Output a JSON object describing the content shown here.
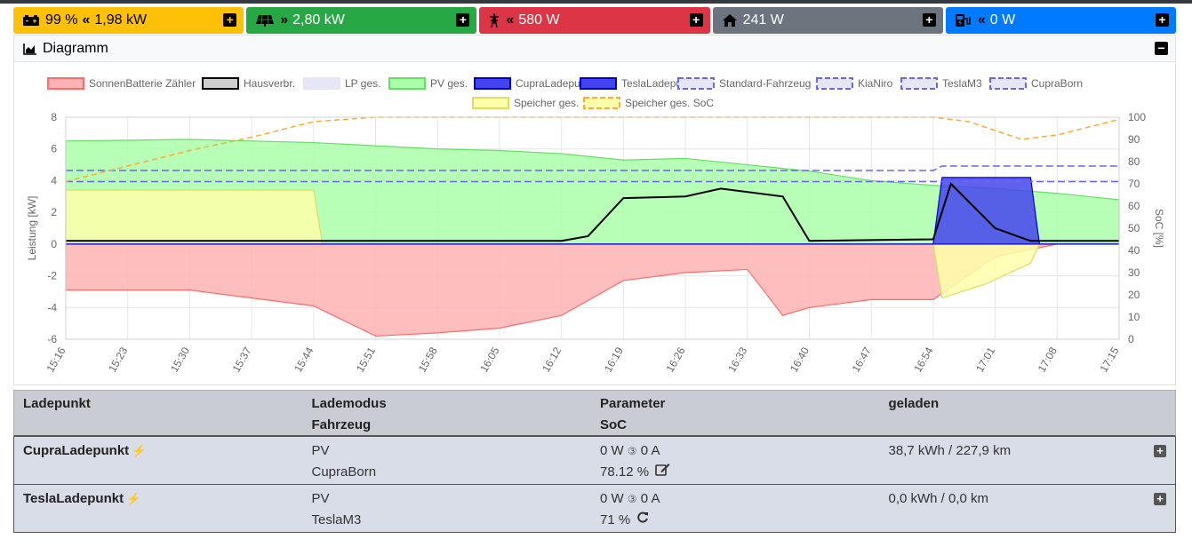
{
  "status": {
    "battery": {
      "soc": "99 %",
      "power": "1,98 kW"
    },
    "pv": {
      "power": "2,80 kW"
    },
    "grid": {
      "power": "580 W"
    },
    "house": {
      "power": "241 W"
    },
    "charge": {
      "power": "0 W"
    }
  },
  "diagram": {
    "title": "Diagramm"
  },
  "chart_data": {
    "type": "line",
    "legend": [
      {
        "name": "SonnenBatterie Zähler",
        "color": "#ff6b6b",
        "fill": "#ffb3b3",
        "dash": false
      },
      {
        "name": "Hausverbr.",
        "color": "#000000",
        "fill": "#cfcfcf",
        "dash": false
      },
      {
        "name": "LP ges.",
        "color": "#e6e6f7",
        "fill": "#e6e6f7",
        "dash": false
      },
      {
        "name": "PV ges.",
        "color": "#66dd66",
        "fill": "#aaffaa",
        "dash": false
      },
      {
        "name": "CupraLadepunkt",
        "color": "#0000cc",
        "fill": "#4444ee",
        "dash": false
      },
      {
        "name": "TeslaLadepunkt",
        "color": "#0000cc",
        "fill": "#4444ee",
        "dash": false
      },
      {
        "name": "Standard-Fahrzeug",
        "color": "#6666ee",
        "fill": "#e6e6f7",
        "dash": true
      },
      {
        "name": "KiaNiro",
        "color": "#6666ee",
        "fill": "#e6e6f7",
        "dash": true
      },
      {
        "name": "TeslaM3",
        "color": "#6666ee",
        "fill": "#e6e6f7",
        "dash": true
      },
      {
        "name": "CupraBorn",
        "color": "#6666ee",
        "fill": "#e6e6f7",
        "dash": true
      },
      {
        "name": "Speicher ges.",
        "color": "#dddd66",
        "fill": "#ffffaa",
        "dash": false
      },
      {
        "name": "Speicher ges. SoC",
        "color": "#ffaa33",
        "fill": "#ffffaa",
        "dash": true
      }
    ],
    "ylabel_left": "Leistung [kW]",
    "ylabel_right": "SoC [%]",
    "ylim_left": [
      -6,
      8
    ],
    "yticks_left": [
      "8",
      "6",
      "4",
      "2",
      "0",
      "-2",
      "-4",
      "-6"
    ],
    "ylim_right": [
      0,
      100
    ],
    "yticks_right": [
      "100",
      "90",
      "80",
      "70",
      "60",
      "50",
      "40",
      "30",
      "20",
      "10",
      "0"
    ],
    "xticks": [
      "15:16",
      "15:23",
      "15:30",
      "15:37",
      "15:44",
      "15:51",
      "15:58",
      "16:05",
      "16:12",
      "16:19",
      "16:26",
      "16:33",
      "16:40",
      "16:47",
      "16:54",
      "17:01",
      "17:08",
      "17:15"
    ],
    "series": [
      {
        "name": "PV ges.",
        "x": [
          "15:16",
          "15:30",
          "15:44",
          "15:58",
          "16:05",
          "16:12",
          "16:19",
          "16:26",
          "16:33",
          "16:40",
          "16:47",
          "16:54",
          "17:01",
          "17:08",
          "17:15"
        ],
        "values": [
          6.5,
          6.6,
          6.4,
          6.0,
          5.9,
          5.7,
          5.3,
          5.4,
          5.0,
          4.6,
          4.0,
          3.7,
          3.5,
          3.2,
          2.8
        ]
      },
      {
        "name": "SonnenBatterie Zähler",
        "x": [
          "15:16",
          "15:30",
          "15:44",
          "15:51",
          "15:58",
          "16:05",
          "16:12",
          "16:19",
          "16:26",
          "16:33",
          "16:37",
          "16:40",
          "16:47",
          "16:54",
          "17:01",
          "17:08",
          "17:15"
        ],
        "values": [
          -2.9,
          -2.9,
          -3.9,
          -5.8,
          -5.6,
          -5.3,
          -4.5,
          -2.3,
          -1.8,
          -1.6,
          -4.5,
          -4.0,
          -3.5,
          -3.5,
          -0.8,
          0.0,
          0.0
        ]
      },
      {
        "name": "Hausverbr.",
        "x": [
          "15:16",
          "15:44",
          "16:12",
          "16:15",
          "16:19",
          "16:26",
          "16:30",
          "16:37",
          "16:40",
          "16:54",
          "16:56",
          "17:01",
          "17:05",
          "17:15"
        ],
        "values": [
          0.2,
          0.2,
          0.2,
          0.5,
          2.9,
          3.0,
          3.5,
          3.0,
          0.2,
          0.3,
          3.8,
          1.0,
          0.2,
          0.2
        ]
      },
      {
        "name": "Speicher ges. SoC",
        "x": [
          "15:16",
          "15:23",
          "15:30",
          "15:37",
          "15:44",
          "15:51",
          "15:58",
          "16:05",
          "16:12",
          "16:19",
          "16:26",
          "16:33",
          "16:40",
          "16:47",
          "16:54",
          "16:58",
          "17:01",
          "17:04",
          "17:08",
          "17:15"
        ],
        "values": [
          71,
          78,
          85,
          91,
          98,
          100,
          100,
          100,
          100,
          100,
          100,
          100,
          100,
          100,
          100,
          98,
          94,
          90,
          92,
          99
        ]
      },
      {
        "name": "Speicher ges.",
        "x": [
          "15:16",
          "15:44",
          "15:45",
          "16:54",
          "16:55",
          "17:00",
          "17:05",
          "17:06",
          "17:15"
        ],
        "values": [
          3.4,
          3.4,
          0.0,
          0.0,
          -3.4,
          -2.5,
          -1.2,
          0.0,
          0.0
        ]
      },
      {
        "name": "CupraLadepunkt",
        "x": [
          "15:16",
          "16:54",
          "16:55",
          "17:05",
          "17:06",
          "17:15"
        ],
        "values": [
          0,
          0,
          4.2,
          4.2,
          0,
          0
        ]
      },
      {
        "name": "TeslaM3",
        "x": [
          "15:16",
          "16:54",
          "17:15"
        ],
        "values": [
          71,
          71,
          71
        ]
      },
      {
        "name": "CupraBorn",
        "x": [
          "15:16",
          "16:54",
          "16:55",
          "17:15"
        ],
        "values": [
          76,
          76,
          78,
          78
        ]
      }
    ]
  },
  "table": {
    "headers": {
      "lp": "Ladepunkt",
      "mode": "Lademodus",
      "vehicle": "Fahrzeug",
      "param": "Parameter",
      "soc": "SoC",
      "charged": "geladen"
    },
    "rows": [
      {
        "name": "CupraLadepunkt",
        "mode": "PV",
        "vehicle": "CupraBorn",
        "param": "0 W",
        "phases": "③",
        "current": "0 A",
        "soc": "78.12 %",
        "charged": "38,7 kWh / 227,9 km"
      },
      {
        "name": "TeslaLadepunkt",
        "mode": "PV",
        "vehicle": "TeslaM3",
        "param": "0 W",
        "phases": "③",
        "current": "0 A",
        "soc": "71 %",
        "charged": "0,0 kWh / 0,0 km"
      }
    ]
  },
  "colors": {
    "battery": "#ffc107",
    "pv": "#28a745",
    "grid": "#dc3545",
    "house": "#6c757d",
    "ev": "#007bff"
  }
}
